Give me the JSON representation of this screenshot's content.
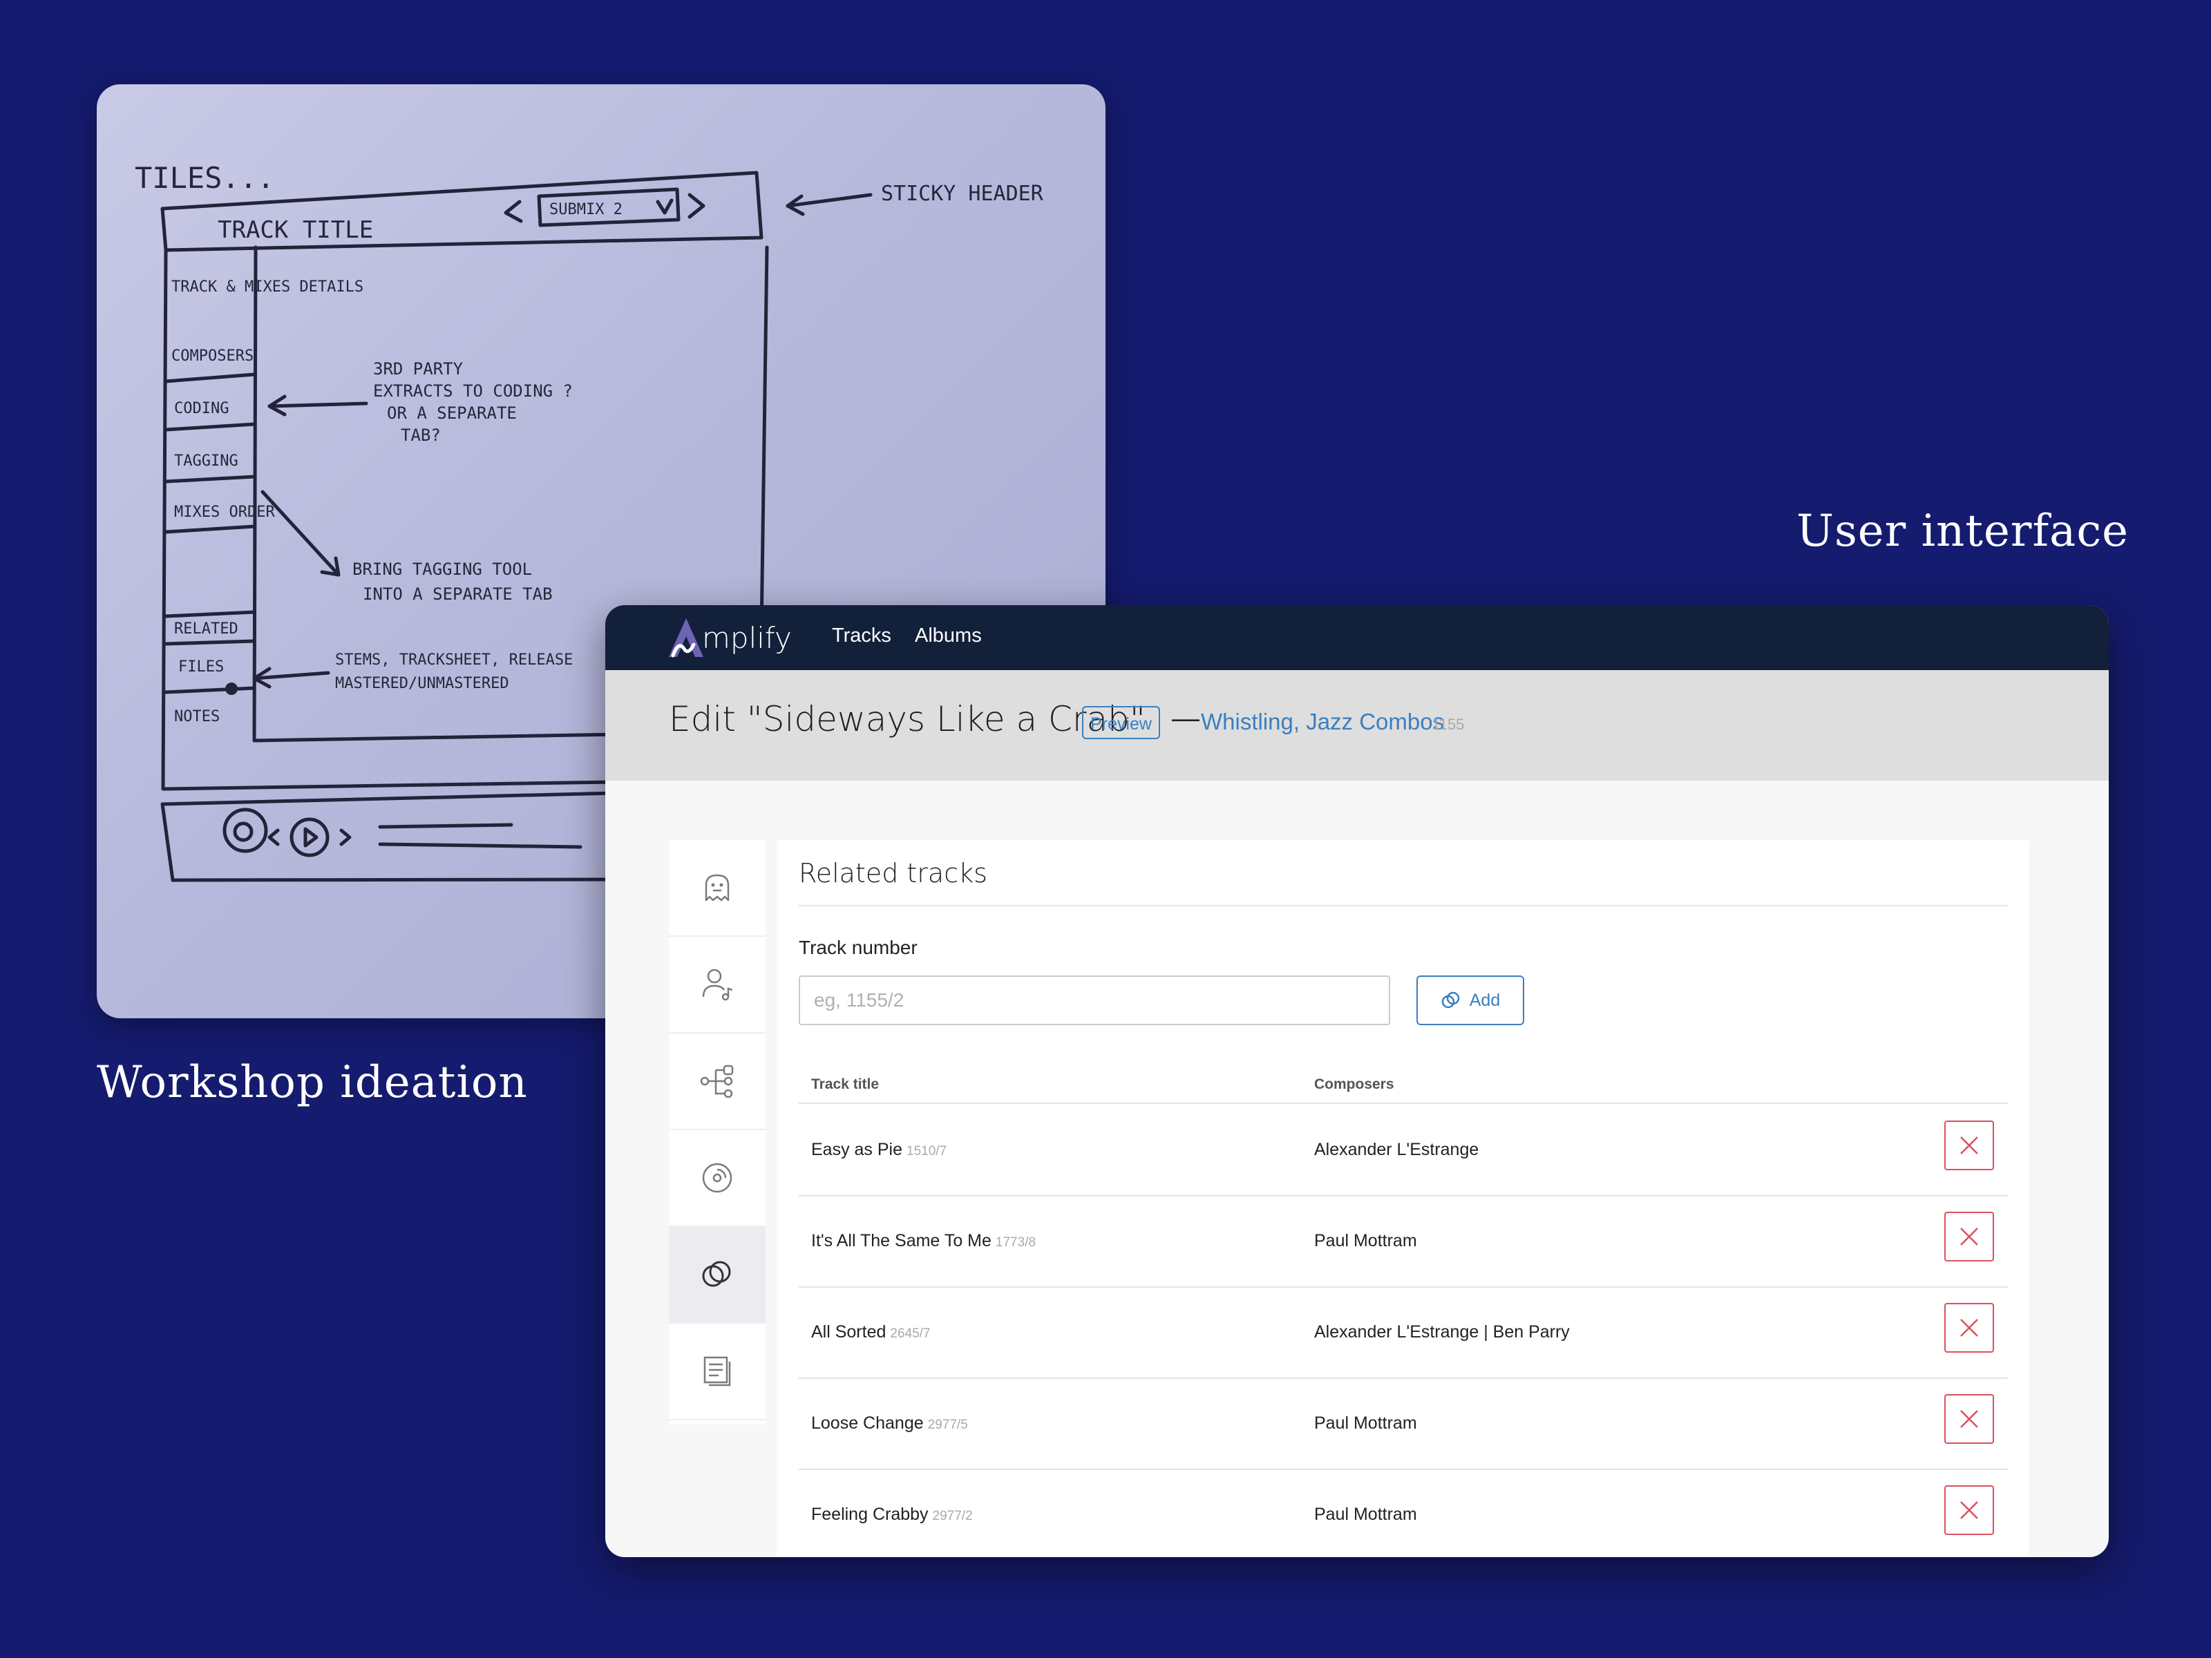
{
  "captions": {
    "user_interface": "User interface",
    "workshop": "Workshop ideation"
  },
  "whiteboard": {
    "tiles": "TILES...",
    "track_title": "TRACK TITLE",
    "submix": "SUBMIX 2",
    "sticky_header": "STICKY HEADER",
    "sidebar_items": [
      "TRACK & MIXES DETAILS",
      "COMPOSERS",
      "CODING",
      "TAGGING",
      "MIXES ORDER",
      "RELATED",
      "FILES",
      "NOTES"
    ],
    "note_third_party": [
      "3RD PARTY",
      "EXTRACTS TO CODING ?",
      "OR A SEPARATE",
      "TAB?"
    ],
    "note_tagging": [
      "BRING TAGGING TOOL",
      "INTO A SEPARATE TAB"
    ],
    "note_files": [
      "STEMS, TRACKSHEET, RELEASE",
      "MASTERED/UNMASTERED"
    ]
  },
  "app": {
    "logo_text": "mplify",
    "nav": [
      "Tracks",
      "Albums"
    ],
    "header": {
      "title": "Edit \"Sideways Like a Crab\"",
      "preview": "Preview",
      "dash": "—",
      "category": "Whistling, Jazz Combos",
      "category_id": "1155"
    },
    "sidebar_icons": [
      "ghost-icon",
      "user-music-icon",
      "tree-icon",
      "disc-icon",
      "related-circles-icon",
      "notes-icon"
    ],
    "panel": {
      "title": "Related tracks",
      "field_label": "Track number",
      "input_value": "",
      "input_placeholder": "eg, 1155/2",
      "add_label": "Add",
      "columns": [
        "Track title",
        "Composers"
      ],
      "rows": [
        {
          "title": "Easy as Pie",
          "number": "1510/7",
          "composers": "Alexander L'Estrange"
        },
        {
          "title": "It's All The Same To Me",
          "number": "1773/8",
          "composers": "Paul Mottram"
        },
        {
          "title": "All Sorted",
          "number": "2645/7",
          "composers": "Alexander L'Estrange | Ben Parry"
        },
        {
          "title": "Loose Change",
          "number": "2977/5",
          "composers": "Paul Mottram"
        },
        {
          "title": "Feeling Crabby",
          "number": "2977/2",
          "composers": "Paul Mottram"
        }
      ]
    }
  },
  "colors": {
    "background": "#151b6e",
    "nav": "#12203a",
    "link": "#3a7fc1",
    "delete": "#d9505c"
  }
}
